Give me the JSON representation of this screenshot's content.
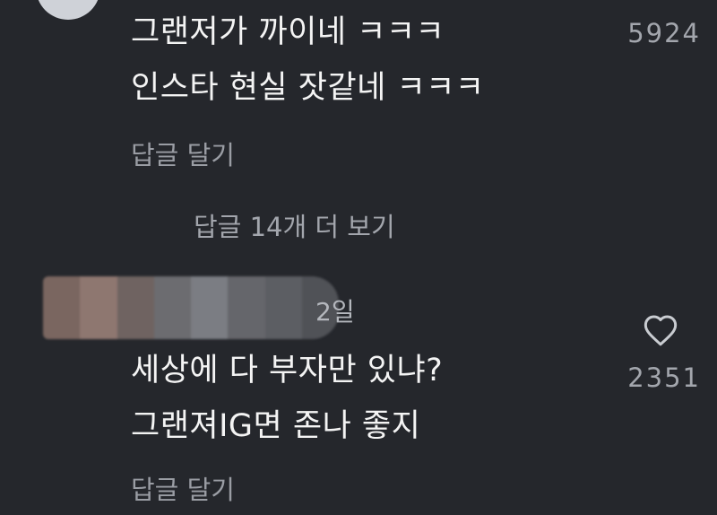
{
  "comment1": {
    "line1": "그랜저가 까이네 ㅋㅋㅋ",
    "line2": "인스타 현실 잣같네 ㅋㅋㅋ",
    "likes": "5924",
    "reply_label": "답글 달기"
  },
  "thread": {
    "more_replies_label": "답글 14개 더 보기"
  },
  "comment2": {
    "time": "2일",
    "line1": "세상에 다 부자만 있냐?",
    "line2": "그랜져IG면 존나 좋지",
    "likes": "2351",
    "reply_label": "답글 달기"
  },
  "icons": {
    "like": "heart-outline-icon"
  },
  "colors": {
    "background": "#25272c",
    "text": "#f4f4f4",
    "muted": "#9a9da4"
  }
}
